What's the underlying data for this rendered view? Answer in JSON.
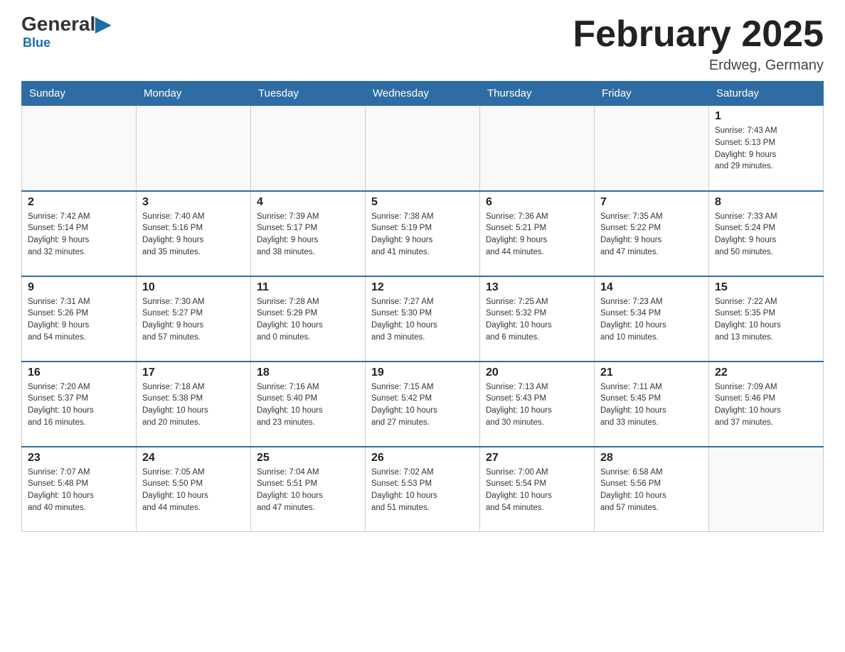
{
  "header": {
    "logo_general": "General",
    "logo_blue": "Blue",
    "month_title": "February 2025",
    "location": "Erdweg, Germany"
  },
  "weekdays": [
    "Sunday",
    "Monday",
    "Tuesday",
    "Wednesday",
    "Thursday",
    "Friday",
    "Saturday"
  ],
  "weeks": [
    [
      {
        "day": "",
        "info": ""
      },
      {
        "day": "",
        "info": ""
      },
      {
        "day": "",
        "info": ""
      },
      {
        "day": "",
        "info": ""
      },
      {
        "day": "",
        "info": ""
      },
      {
        "day": "",
        "info": ""
      },
      {
        "day": "1",
        "info": "Sunrise: 7:43 AM\nSunset: 5:13 PM\nDaylight: 9 hours\nand 29 minutes."
      }
    ],
    [
      {
        "day": "2",
        "info": "Sunrise: 7:42 AM\nSunset: 5:14 PM\nDaylight: 9 hours\nand 32 minutes."
      },
      {
        "day": "3",
        "info": "Sunrise: 7:40 AM\nSunset: 5:16 PM\nDaylight: 9 hours\nand 35 minutes."
      },
      {
        "day": "4",
        "info": "Sunrise: 7:39 AM\nSunset: 5:17 PM\nDaylight: 9 hours\nand 38 minutes."
      },
      {
        "day": "5",
        "info": "Sunrise: 7:38 AM\nSunset: 5:19 PM\nDaylight: 9 hours\nand 41 minutes."
      },
      {
        "day": "6",
        "info": "Sunrise: 7:36 AM\nSunset: 5:21 PM\nDaylight: 9 hours\nand 44 minutes."
      },
      {
        "day": "7",
        "info": "Sunrise: 7:35 AM\nSunset: 5:22 PM\nDaylight: 9 hours\nand 47 minutes."
      },
      {
        "day": "8",
        "info": "Sunrise: 7:33 AM\nSunset: 5:24 PM\nDaylight: 9 hours\nand 50 minutes."
      }
    ],
    [
      {
        "day": "9",
        "info": "Sunrise: 7:31 AM\nSunset: 5:26 PM\nDaylight: 9 hours\nand 54 minutes."
      },
      {
        "day": "10",
        "info": "Sunrise: 7:30 AM\nSunset: 5:27 PM\nDaylight: 9 hours\nand 57 minutes."
      },
      {
        "day": "11",
        "info": "Sunrise: 7:28 AM\nSunset: 5:29 PM\nDaylight: 10 hours\nand 0 minutes."
      },
      {
        "day": "12",
        "info": "Sunrise: 7:27 AM\nSunset: 5:30 PM\nDaylight: 10 hours\nand 3 minutes."
      },
      {
        "day": "13",
        "info": "Sunrise: 7:25 AM\nSunset: 5:32 PM\nDaylight: 10 hours\nand 6 minutes."
      },
      {
        "day": "14",
        "info": "Sunrise: 7:23 AM\nSunset: 5:34 PM\nDaylight: 10 hours\nand 10 minutes."
      },
      {
        "day": "15",
        "info": "Sunrise: 7:22 AM\nSunset: 5:35 PM\nDaylight: 10 hours\nand 13 minutes."
      }
    ],
    [
      {
        "day": "16",
        "info": "Sunrise: 7:20 AM\nSunset: 5:37 PM\nDaylight: 10 hours\nand 16 minutes."
      },
      {
        "day": "17",
        "info": "Sunrise: 7:18 AM\nSunset: 5:38 PM\nDaylight: 10 hours\nand 20 minutes."
      },
      {
        "day": "18",
        "info": "Sunrise: 7:16 AM\nSunset: 5:40 PM\nDaylight: 10 hours\nand 23 minutes."
      },
      {
        "day": "19",
        "info": "Sunrise: 7:15 AM\nSunset: 5:42 PM\nDaylight: 10 hours\nand 27 minutes."
      },
      {
        "day": "20",
        "info": "Sunrise: 7:13 AM\nSunset: 5:43 PM\nDaylight: 10 hours\nand 30 minutes."
      },
      {
        "day": "21",
        "info": "Sunrise: 7:11 AM\nSunset: 5:45 PM\nDaylight: 10 hours\nand 33 minutes."
      },
      {
        "day": "22",
        "info": "Sunrise: 7:09 AM\nSunset: 5:46 PM\nDaylight: 10 hours\nand 37 minutes."
      }
    ],
    [
      {
        "day": "23",
        "info": "Sunrise: 7:07 AM\nSunset: 5:48 PM\nDaylight: 10 hours\nand 40 minutes."
      },
      {
        "day": "24",
        "info": "Sunrise: 7:05 AM\nSunset: 5:50 PM\nDaylight: 10 hours\nand 44 minutes."
      },
      {
        "day": "25",
        "info": "Sunrise: 7:04 AM\nSunset: 5:51 PM\nDaylight: 10 hours\nand 47 minutes."
      },
      {
        "day": "26",
        "info": "Sunrise: 7:02 AM\nSunset: 5:53 PM\nDaylight: 10 hours\nand 51 minutes."
      },
      {
        "day": "27",
        "info": "Sunrise: 7:00 AM\nSunset: 5:54 PM\nDaylight: 10 hours\nand 54 minutes."
      },
      {
        "day": "28",
        "info": "Sunrise: 6:58 AM\nSunset: 5:56 PM\nDaylight: 10 hours\nand 57 minutes."
      },
      {
        "day": "",
        "info": ""
      }
    ]
  ]
}
